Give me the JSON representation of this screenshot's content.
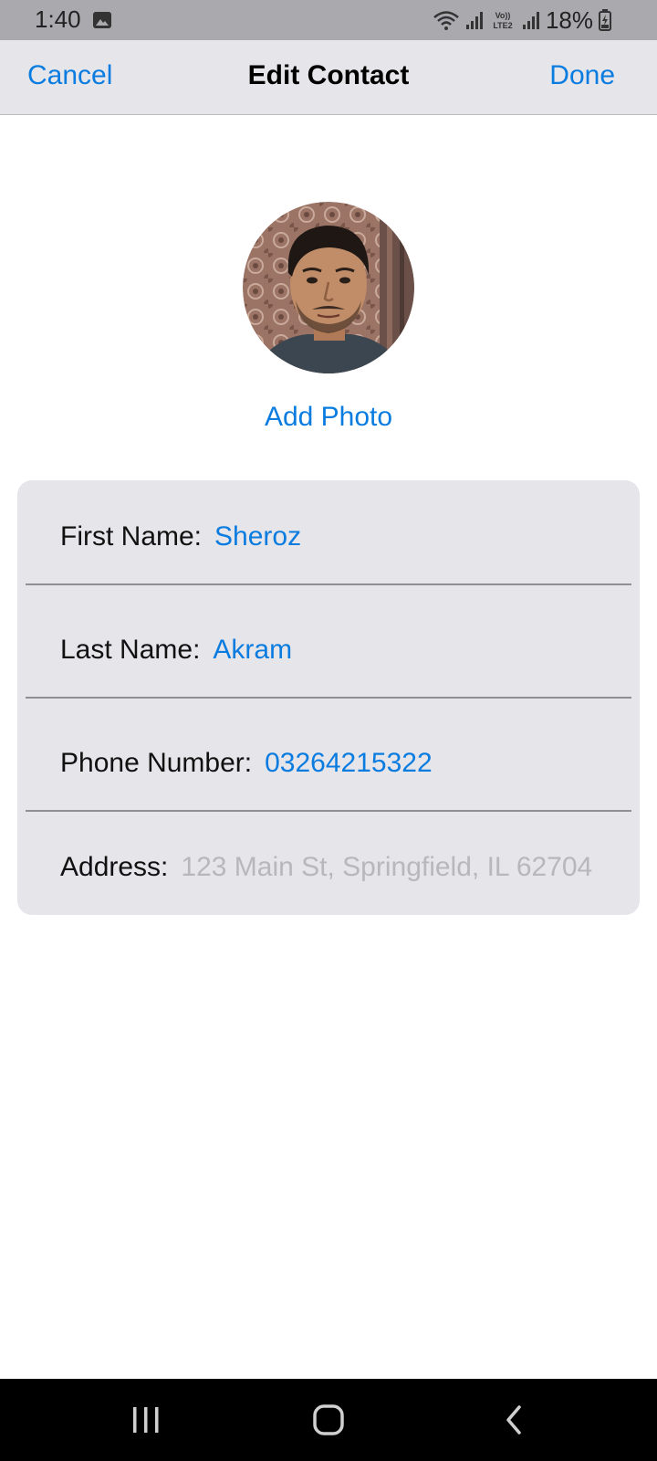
{
  "status_bar": {
    "time": "1:40",
    "battery": "18%",
    "icons": [
      "gallery-notification-icon",
      "wifi-icon",
      "signal-icon",
      "volte-lte2-icon",
      "signal-icon-2",
      "battery-charging-icon"
    ]
  },
  "nav": {
    "cancel_label": "Cancel",
    "title": "Edit Contact",
    "done_label": "Done"
  },
  "photo": {
    "add_photo_label": "Add Photo"
  },
  "form": {
    "first_name": {
      "label": "First Name:",
      "value": "Sheroz"
    },
    "last_name": {
      "label": "Last Name:",
      "value": "Akram"
    },
    "phone": {
      "label": "Phone Number:",
      "value": "03264215322"
    },
    "address": {
      "label": "Address:",
      "placeholder": "123 Main St, Springfield, IL 62704"
    }
  },
  "colors": {
    "accent": "#0a7ce0",
    "card_background": "#e5e5ea",
    "placeholder": "#b7b7bc",
    "status_bar": "#a9a9ae"
  }
}
